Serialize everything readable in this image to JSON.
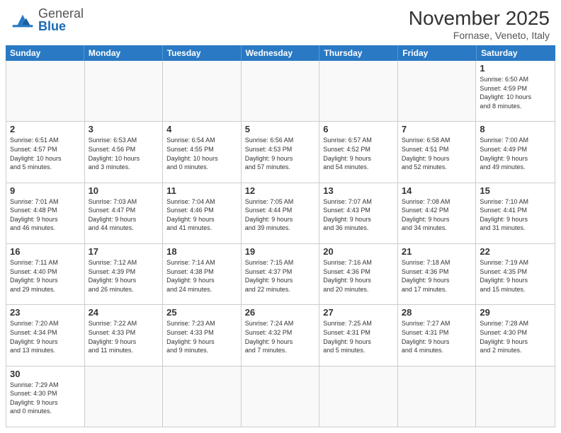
{
  "header": {
    "logo_general": "General",
    "logo_blue": "Blue",
    "month_title": "November 2025",
    "location": "Fornase, Veneto, Italy"
  },
  "weekdays": [
    "Sunday",
    "Monday",
    "Tuesday",
    "Wednesday",
    "Thursday",
    "Friday",
    "Saturday"
  ],
  "rows": [
    [
      {
        "day": "",
        "info": ""
      },
      {
        "day": "",
        "info": ""
      },
      {
        "day": "",
        "info": ""
      },
      {
        "day": "",
        "info": ""
      },
      {
        "day": "",
        "info": ""
      },
      {
        "day": "",
        "info": ""
      },
      {
        "day": "1",
        "info": "Sunrise: 6:50 AM\nSunset: 4:59 PM\nDaylight: 10 hours\nand 8 minutes."
      }
    ],
    [
      {
        "day": "2",
        "info": "Sunrise: 6:51 AM\nSunset: 4:57 PM\nDaylight: 10 hours\nand 5 minutes."
      },
      {
        "day": "3",
        "info": "Sunrise: 6:53 AM\nSunset: 4:56 PM\nDaylight: 10 hours\nand 3 minutes."
      },
      {
        "day": "4",
        "info": "Sunrise: 6:54 AM\nSunset: 4:55 PM\nDaylight: 10 hours\nand 0 minutes."
      },
      {
        "day": "5",
        "info": "Sunrise: 6:56 AM\nSunset: 4:53 PM\nDaylight: 9 hours\nand 57 minutes."
      },
      {
        "day": "6",
        "info": "Sunrise: 6:57 AM\nSunset: 4:52 PM\nDaylight: 9 hours\nand 54 minutes."
      },
      {
        "day": "7",
        "info": "Sunrise: 6:58 AM\nSunset: 4:51 PM\nDaylight: 9 hours\nand 52 minutes."
      },
      {
        "day": "8",
        "info": "Sunrise: 7:00 AM\nSunset: 4:49 PM\nDaylight: 9 hours\nand 49 minutes."
      }
    ],
    [
      {
        "day": "9",
        "info": "Sunrise: 7:01 AM\nSunset: 4:48 PM\nDaylight: 9 hours\nand 46 minutes."
      },
      {
        "day": "10",
        "info": "Sunrise: 7:03 AM\nSunset: 4:47 PM\nDaylight: 9 hours\nand 44 minutes."
      },
      {
        "day": "11",
        "info": "Sunrise: 7:04 AM\nSunset: 4:46 PM\nDaylight: 9 hours\nand 41 minutes."
      },
      {
        "day": "12",
        "info": "Sunrise: 7:05 AM\nSunset: 4:44 PM\nDaylight: 9 hours\nand 39 minutes."
      },
      {
        "day": "13",
        "info": "Sunrise: 7:07 AM\nSunset: 4:43 PM\nDaylight: 9 hours\nand 36 minutes."
      },
      {
        "day": "14",
        "info": "Sunrise: 7:08 AM\nSunset: 4:42 PM\nDaylight: 9 hours\nand 34 minutes."
      },
      {
        "day": "15",
        "info": "Sunrise: 7:10 AM\nSunset: 4:41 PM\nDaylight: 9 hours\nand 31 minutes."
      }
    ],
    [
      {
        "day": "16",
        "info": "Sunrise: 7:11 AM\nSunset: 4:40 PM\nDaylight: 9 hours\nand 29 minutes."
      },
      {
        "day": "17",
        "info": "Sunrise: 7:12 AM\nSunset: 4:39 PM\nDaylight: 9 hours\nand 26 minutes."
      },
      {
        "day": "18",
        "info": "Sunrise: 7:14 AM\nSunset: 4:38 PM\nDaylight: 9 hours\nand 24 minutes."
      },
      {
        "day": "19",
        "info": "Sunrise: 7:15 AM\nSunset: 4:37 PM\nDaylight: 9 hours\nand 22 minutes."
      },
      {
        "day": "20",
        "info": "Sunrise: 7:16 AM\nSunset: 4:36 PM\nDaylight: 9 hours\nand 20 minutes."
      },
      {
        "day": "21",
        "info": "Sunrise: 7:18 AM\nSunset: 4:36 PM\nDaylight: 9 hours\nand 17 minutes."
      },
      {
        "day": "22",
        "info": "Sunrise: 7:19 AM\nSunset: 4:35 PM\nDaylight: 9 hours\nand 15 minutes."
      }
    ],
    [
      {
        "day": "23",
        "info": "Sunrise: 7:20 AM\nSunset: 4:34 PM\nDaylight: 9 hours\nand 13 minutes."
      },
      {
        "day": "24",
        "info": "Sunrise: 7:22 AM\nSunset: 4:33 PM\nDaylight: 9 hours\nand 11 minutes."
      },
      {
        "day": "25",
        "info": "Sunrise: 7:23 AM\nSunset: 4:33 PM\nDaylight: 9 hours\nand 9 minutes."
      },
      {
        "day": "26",
        "info": "Sunrise: 7:24 AM\nSunset: 4:32 PM\nDaylight: 9 hours\nand 7 minutes."
      },
      {
        "day": "27",
        "info": "Sunrise: 7:25 AM\nSunset: 4:31 PM\nDaylight: 9 hours\nand 5 minutes."
      },
      {
        "day": "28",
        "info": "Sunrise: 7:27 AM\nSunset: 4:31 PM\nDaylight: 9 hours\nand 4 minutes."
      },
      {
        "day": "29",
        "info": "Sunrise: 7:28 AM\nSunset: 4:30 PM\nDaylight: 9 hours\nand 2 minutes."
      }
    ],
    [
      {
        "day": "30",
        "info": "Sunrise: 7:29 AM\nSunset: 4:30 PM\nDaylight: 9 hours\nand 0 minutes."
      },
      {
        "day": "",
        "info": ""
      },
      {
        "day": "",
        "info": ""
      },
      {
        "day": "",
        "info": ""
      },
      {
        "day": "",
        "info": ""
      },
      {
        "day": "",
        "info": ""
      },
      {
        "day": "",
        "info": ""
      }
    ]
  ]
}
